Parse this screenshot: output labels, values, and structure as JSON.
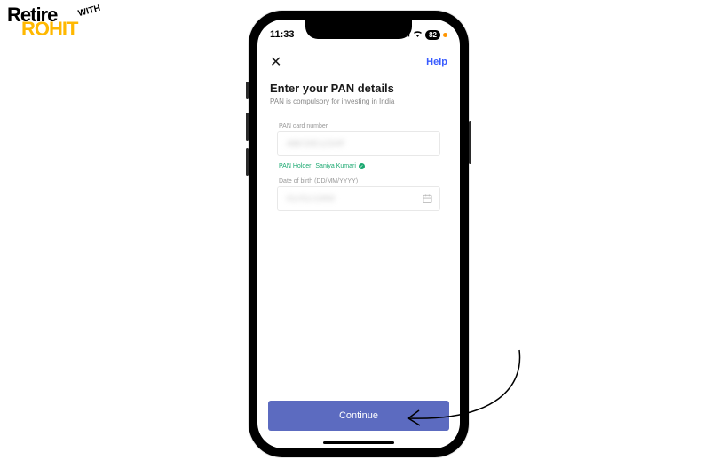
{
  "logo": {
    "line1": "Retire",
    "line2": "ROHIT",
    "with": "WITH"
  },
  "status": {
    "time": "11:33",
    "battery": "82"
  },
  "header": {
    "close": "✕",
    "help": "Help"
  },
  "page": {
    "title": "Enter your PAN details",
    "subtitle": "PAN is compulsory for investing in India"
  },
  "pan_field": {
    "label": "PAN card number",
    "value": "ABCDE1234F"
  },
  "pan_holder": {
    "prefix": "PAN Holder:",
    "name": "Saniya Kumari"
  },
  "dob_field": {
    "label": "Date of birth (DD/MM/YYYY)",
    "value": "01/01/1990"
  },
  "cta": {
    "label": "Continue"
  }
}
